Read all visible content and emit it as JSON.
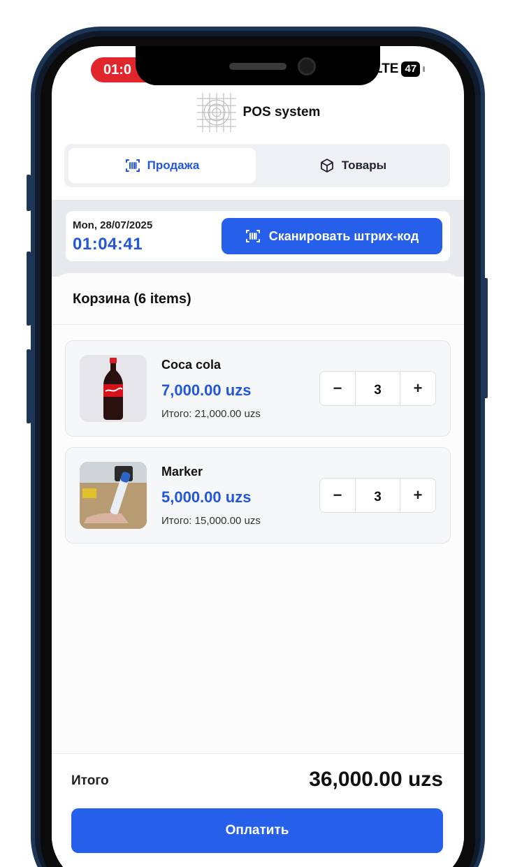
{
  "status_bar": {
    "time": "01:0",
    "network": "LTE",
    "battery": "47"
  },
  "header": {
    "title": "POS system",
    "logo_icon": "grid-target-icon"
  },
  "tabs": [
    {
      "label": "Продажа",
      "icon": "barcode-icon",
      "active": true
    },
    {
      "label": "Товары",
      "icon": "box-icon",
      "active": false
    }
  ],
  "datetime": {
    "date": "Mon, 28/07/2025",
    "time": "01:04:41"
  },
  "scan_button": {
    "label": "Сканировать штрих-код",
    "icon": "barcode-icon"
  },
  "cart": {
    "title": "Корзина (6 items)",
    "items": [
      {
        "name": "Coca cola",
        "price": "7,000.00 uzs",
        "total": "Итого: 21,000.00 uzs",
        "quantity": "3",
        "image": "cola-bottle"
      },
      {
        "name": "Marker",
        "price": "5,000.00 uzs",
        "total": "Итого: 15,000.00 uzs",
        "quantity": "3",
        "image": "marker-photo"
      }
    ],
    "decrement": "−",
    "increment": "+"
  },
  "footer": {
    "total_label": "Итого",
    "total_value": "36,000.00 uzs",
    "pay_label": "Оплатить"
  },
  "colors": {
    "accent": "#2660ea",
    "accent_text": "#2157d8",
    "status_red": "#e0262c"
  }
}
